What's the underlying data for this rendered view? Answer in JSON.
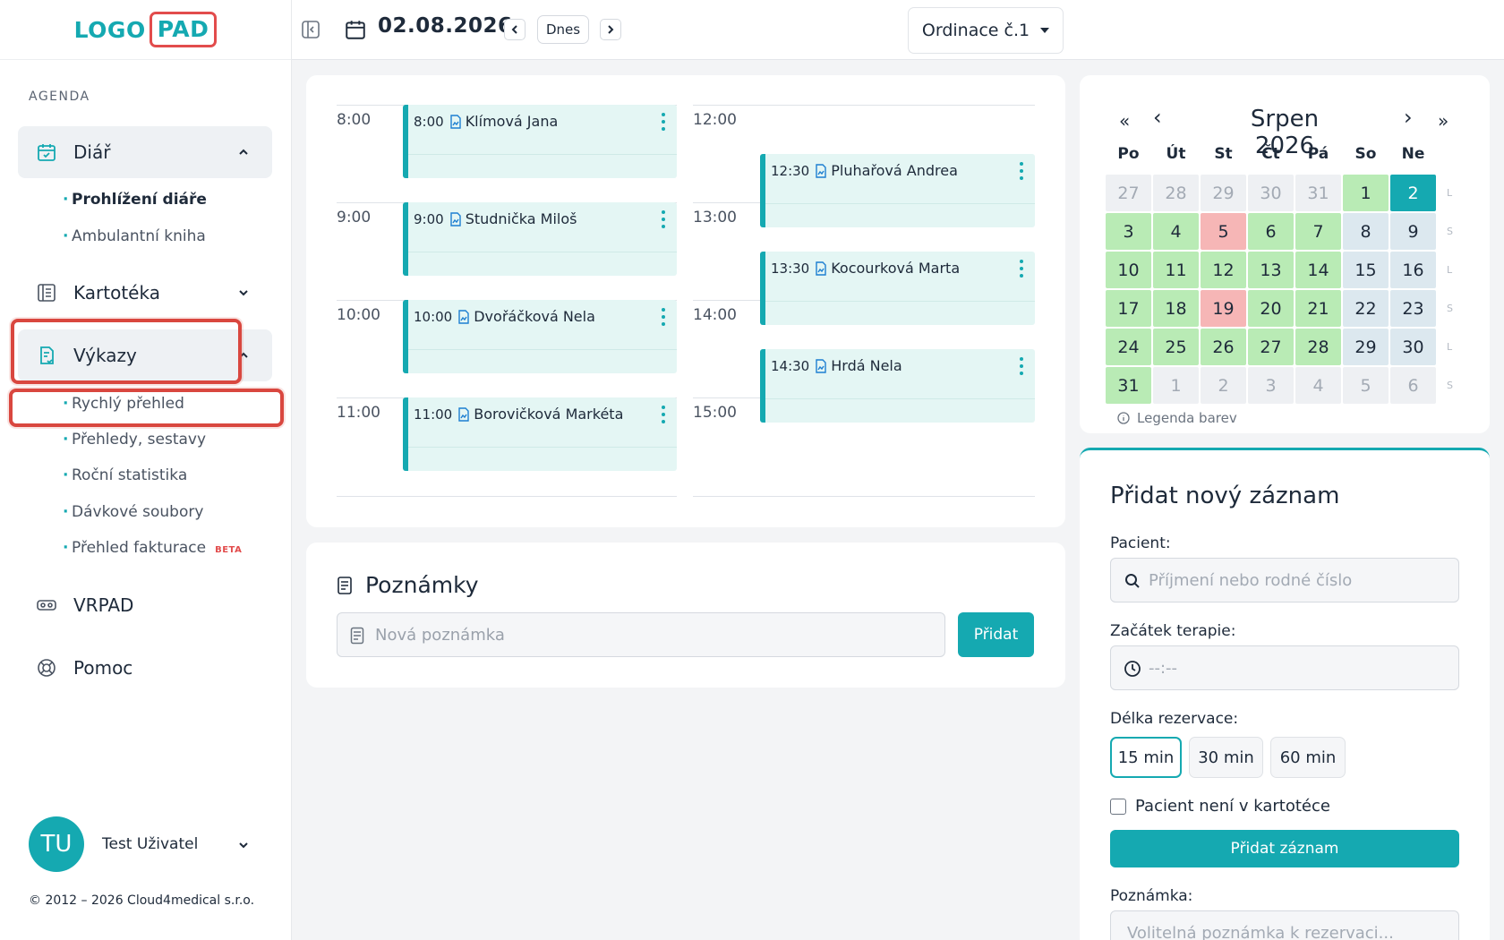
{
  "logo": {
    "part1": "LOGO",
    "part2": "PAD"
  },
  "sidebar": {
    "section_label": "AGENDA",
    "diar": {
      "label": "Diář",
      "items": [
        "Prohlížení diáře",
        "Ambulantní kniha"
      ]
    },
    "kartoteka": {
      "label": "Kartotéka"
    },
    "vykazy": {
      "label": "Výkazy",
      "items": [
        "Rychlý přehled",
        "Přehledy, sestavy",
        "Roční statistika",
        "Dávkové soubory",
        "Přehled fakturace"
      ],
      "beta": "BETA"
    },
    "vrpad": {
      "label": "VRPAD"
    },
    "pomoc": {
      "label": "Pomoc"
    }
  },
  "user": {
    "initials": "TU",
    "name": "Test Uživatel"
  },
  "footer": {
    "copyright": "© 2012 – 2026 Cloud4medical s.r.o."
  },
  "topbar": {
    "date": "02.08.2026",
    "today_label": "Dnes",
    "office": "Ordinace č.1"
  },
  "schedule": {
    "hours_left": [
      "8:00",
      "9:00",
      "10:00",
      "11:00"
    ],
    "hours_right": [
      "12:00",
      "13:00",
      "14:00",
      "15:00"
    ],
    "appointments": [
      {
        "time": "8:00",
        "name": "Klímová Jana"
      },
      {
        "time": "9:00",
        "name": "Studnička Miloš"
      },
      {
        "time": "10:00",
        "name": "Dvořáčková Nela"
      },
      {
        "time": "11:00",
        "name": "Borovičková Markéta"
      },
      {
        "time": "12:30",
        "name": "Pluhařová Andrea"
      },
      {
        "time": "13:30",
        "name": "Kocourková Marta"
      },
      {
        "time": "14:30",
        "name": "Hrdá Nela"
      }
    ]
  },
  "notes": {
    "title": "Poznámky",
    "placeholder": "Nová poznámka",
    "add_label": "Přidat"
  },
  "calendar": {
    "title": "Srpen 2026",
    "prev_year": "«",
    "prev": "‹",
    "next": "›",
    "next_year": "»",
    "weekdays": [
      "Po",
      "Út",
      "St",
      "Čt",
      "Pá",
      "So",
      "Ne"
    ],
    "weeks": [
      [
        [
          "27",
          "out"
        ],
        [
          "28",
          "out"
        ],
        [
          "29",
          "out"
        ],
        [
          "30",
          "out"
        ],
        [
          "31",
          "out"
        ],
        [
          "1",
          "green"
        ],
        [
          "2",
          "today"
        ]
      ],
      [
        [
          "3",
          "green"
        ],
        [
          "4",
          "green"
        ],
        [
          "5",
          "red"
        ],
        [
          "6",
          "green"
        ],
        [
          "7",
          "green"
        ],
        [
          "8",
          "blue"
        ],
        [
          "9",
          "blue"
        ]
      ],
      [
        [
          "10",
          "green"
        ],
        [
          "11",
          "green"
        ],
        [
          "12",
          "green"
        ],
        [
          "13",
          "green"
        ],
        [
          "14",
          "green"
        ],
        [
          "15",
          "blue"
        ],
        [
          "16",
          "blue"
        ]
      ],
      [
        [
          "17",
          "green"
        ],
        [
          "18",
          "green"
        ],
        [
          "19",
          "red"
        ],
        [
          "20",
          "green"
        ],
        [
          "21",
          "green"
        ],
        [
          "22",
          "blue"
        ],
        [
          "23",
          "blue"
        ]
      ],
      [
        [
          "24",
          "green"
        ],
        [
          "25",
          "green"
        ],
        [
          "26",
          "green"
        ],
        [
          "27",
          "green"
        ],
        [
          "28",
          "green"
        ],
        [
          "29",
          "blue"
        ],
        [
          "30",
          "blue"
        ]
      ],
      [
        [
          "31",
          "green"
        ],
        [
          "1",
          "out"
        ],
        [
          "2",
          "out"
        ],
        [
          "3",
          "out"
        ],
        [
          "4",
          "out"
        ],
        [
          "5",
          "out"
        ],
        [
          "6",
          "out"
        ]
      ]
    ],
    "week_marks": [
      "L",
      "S",
      "L",
      "S",
      "L",
      "S"
    ],
    "legend": "Legenda barev",
    "colors": {
      "green": "#b9ebb5",
      "red": "#f6b6b6",
      "blue": "#dce8ef",
      "today": "#15a9b1"
    }
  },
  "form": {
    "title": "Přidat nový záznam",
    "patient_label": "Pacient:",
    "patient_placeholder": "Příjmení nebo rodné číslo",
    "start_label": "Začátek terapie:",
    "start_placeholder": "--:--",
    "duration_label": "Délka rezervace:",
    "durations": [
      "15 min",
      "30 min",
      "60 min"
    ],
    "checkbox_label": "Pacient není v kartotéce",
    "submit_label": "Přidat záznam",
    "note_label": "Poznámka:",
    "note_placeholder": "Volitelná poznámka k rezervaci..."
  },
  "accent": "#15a9b1",
  "highlight": "#d9473f"
}
